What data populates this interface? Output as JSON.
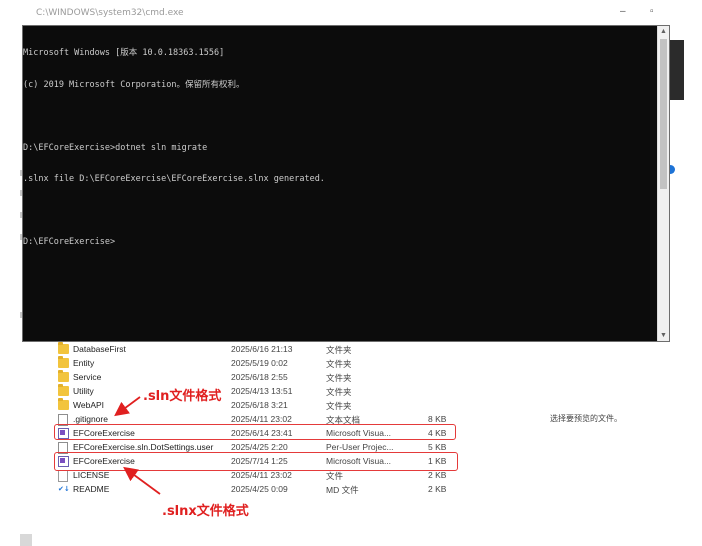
{
  "explorer": {
    "title_path": "C:\\WINDOWS\\system32\\cmd.exe",
    "min_glyph": "–",
    "restore_glyph": "▫",
    "files": [
      {
        "icon": "folder",
        "name": "DatabaseFirst",
        "date": "2025/6/16 21:13",
        "type": "文件夹",
        "size": ""
      },
      {
        "icon": "folder",
        "name": "Entity",
        "date": "2025/5/19 0:02",
        "type": "文件夹",
        "size": ""
      },
      {
        "icon": "folder",
        "name": "Service",
        "date": "2025/6/18 2:55",
        "type": "文件夹",
        "size": ""
      },
      {
        "icon": "folder",
        "name": "Utility",
        "date": "2025/4/13 13:51",
        "type": "文件夹",
        "size": ""
      },
      {
        "icon": "folder",
        "name": "WebAPI",
        "date": "2025/6/18 3:21",
        "type": "文件夹",
        "size": ""
      },
      {
        "icon": "doc",
        "name": ".gitignore",
        "date": "2025/4/11 23:02",
        "type": "文本文档",
        "size": "8 KB"
      },
      {
        "icon": "vs",
        "name": "EFCoreExercise",
        "date": "2025/6/14 23:41",
        "type": "Microsoft Visua...",
        "size": "4 KB"
      },
      {
        "icon": "doc",
        "name": "EFCoreExercise.sln.DotSettings.user",
        "date": "2025/4/25 2:20",
        "type": "Per-User Projec...",
        "size": "5 KB"
      },
      {
        "icon": "vs",
        "name": "EFCoreExercise",
        "date": "2025/7/14 1:25",
        "type": "Microsoft Visua...",
        "size": "1 KB"
      },
      {
        "icon": "lic",
        "name": "LICENSE",
        "date": "2025/4/11 23:02",
        "type": "文件",
        "size": "2 KB"
      },
      {
        "icon": "md",
        "name": "README",
        "date": "2025/4/25 0:09",
        "type": "MD 文件",
        "size": "2 KB"
      }
    ],
    "preview_text": "选择要预览的文件。",
    "md_glyph": "✔↓"
  },
  "annotations": {
    "sln_label": ".sln文件格式",
    "slnx_label": ".slnx文件格式",
    "color": "#e02020"
  },
  "console": {
    "lines": [
      "Microsoft Windows [版本 10.0.18363.1556]",
      "(c) 2019 Microsoft Corporation。保留所有权利。",
      "",
      "D:\\EFCoreExercise>dotnet sln migrate",
      ".slnx file D:\\EFCoreExercise\\EFCoreExercise.slnx generated.",
      "",
      "D:\\EFCoreExercise>"
    ],
    "scroll_up_glyph": "▲",
    "scroll_down_glyph": "▼"
  }
}
